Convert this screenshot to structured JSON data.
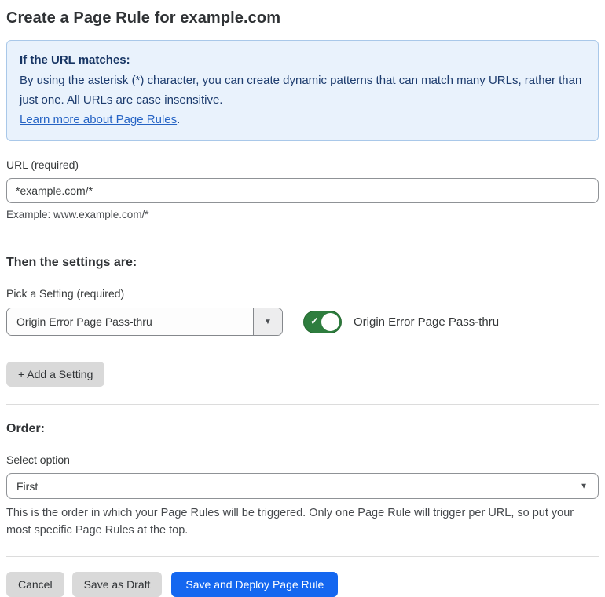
{
  "page": {
    "title": "Create a Page Rule for example.com"
  },
  "info_box": {
    "heading": "If the URL matches:",
    "body": "By using the asterisk (*) character, you can create dynamic patterns that can match many URLs, rather than just one. All URLs are case insensitive.",
    "link_label": "Learn more about Page Rules",
    "link_suffix": "."
  },
  "url_field": {
    "label": "URL (required)",
    "value": "*example.com/*",
    "helper": "Example: www.example.com/*"
  },
  "settings_section": {
    "heading": "Then the settings are:",
    "picker_label": "Pick a Setting (required)",
    "selected_setting": "Origin Error Page Pass-thru",
    "dropdown_arrow": "▼",
    "toggle_state": "on",
    "toggle_check": "✓",
    "toggle_label": "Origin Error Page Pass-thru",
    "add_setting_button": "+ Add a Setting"
  },
  "order_section": {
    "heading": "Order:",
    "select_label": "Select option",
    "selected_option": "First",
    "dropdown_arrow": "▼",
    "helper": "This is the order in which your Page Rules will be triggered. Only one Page Rule will trigger per URL, so put your most specific Page Rules at the top."
  },
  "footer": {
    "cancel_label": "Cancel",
    "save_draft_label": "Save as Draft",
    "save_deploy_label": "Save and Deploy Page Rule"
  },
  "colors": {
    "info_background": "#e9f2fc",
    "info_border": "#a9c8e9",
    "info_text": "#1d3c6e",
    "link_blue": "#2563c4",
    "toggle_green": "#2e7d3e",
    "primary_button_blue": "#1467f0",
    "secondary_button_gray": "#d9d9d9",
    "text_dark": "#36393a",
    "text_muted": "#46494d"
  }
}
